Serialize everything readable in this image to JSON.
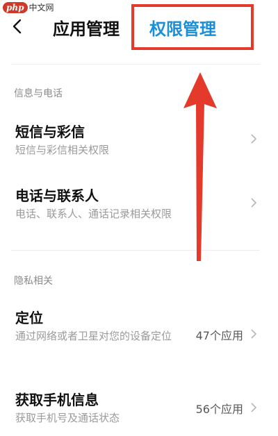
{
  "watermark": {
    "logo": "php",
    "text": "中文网"
  },
  "header": {
    "tab_app": "应用管理",
    "tab_permission": "权限管理"
  },
  "sections": [
    {
      "title": "信息与电话",
      "items": [
        {
          "title": "短信与彩信",
          "subtitle": "短信与彩信相关权限",
          "count": ""
        },
        {
          "title": "电话与联系人",
          "subtitle": "电话、联系人、通话记录相关权限",
          "count": ""
        }
      ]
    },
    {
      "title": "隐私相关",
      "items": [
        {
          "title": "定位",
          "subtitle": "通过网络或者卫星对您的设备定位",
          "count": "47个应用"
        },
        {
          "title": "获取手机信息",
          "subtitle": "获取手机号及通话状态",
          "count": "56个应用"
        }
      ]
    }
  ],
  "colors": {
    "accent": "#1a8fd8",
    "annotation": "#e33a2c"
  }
}
